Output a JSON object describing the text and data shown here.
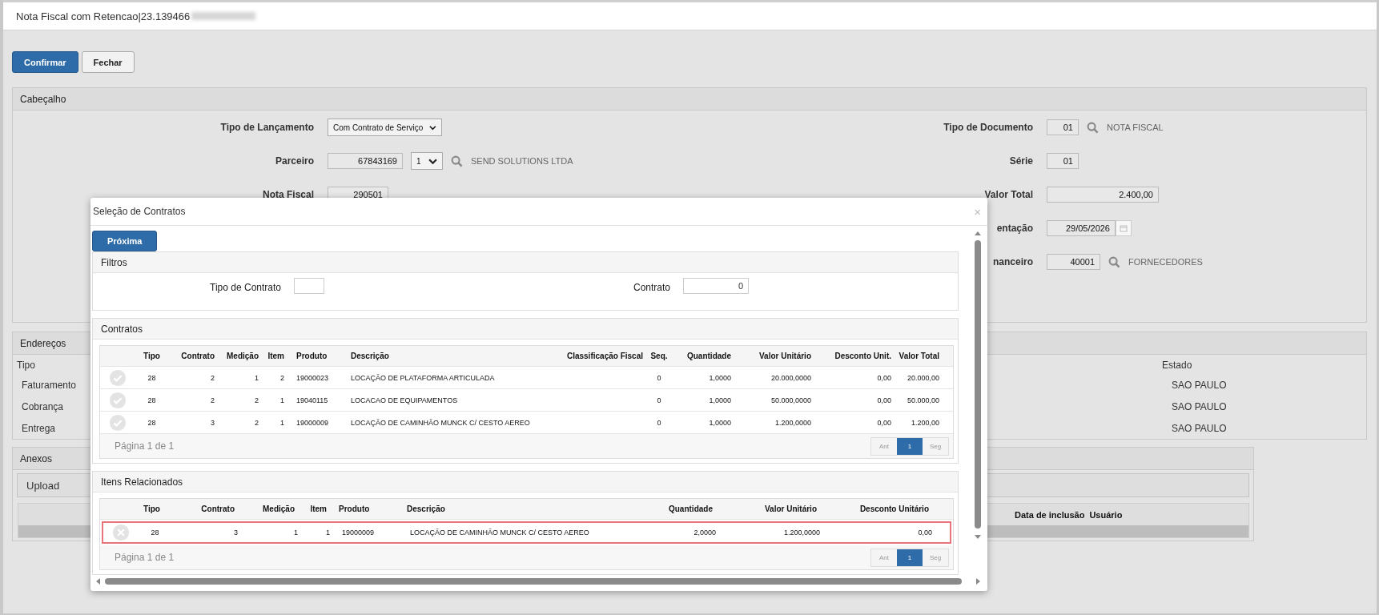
{
  "window": {
    "title": "Nota Fiscal com Retencao|23.139466"
  },
  "toolbar": [
    {
      "label": "Confirmar",
      "kind": "primary"
    },
    {
      "label": "Fechar",
      "kind": "default"
    }
  ],
  "cabecalho": {
    "title": "Cabeçalho",
    "left_fields": [
      {
        "label": "Tipo de Lançamento",
        "kind": "select",
        "value": "Com Contrato de Serviço"
      },
      {
        "label": "Parceiro",
        "kind": "input",
        "value": "67843169",
        "select": "1",
        "lookup": true,
        "description": "SEND SOLUTIONS LTDA"
      },
      {
        "label": "Nota Fiscal",
        "kind": "input",
        "value": "290501"
      }
    ],
    "right_fields": [
      {
        "label": "Tipo de Documento",
        "kind": "input",
        "value": "01",
        "lookup": true,
        "description": "NOTA FISCAL"
      },
      {
        "label": "Série",
        "kind": "input",
        "value": "01"
      },
      {
        "label": "Valor Total",
        "kind": "input",
        "value": "2.400,00"
      },
      {
        "label": "entação",
        "kind": "date",
        "value": "29/05/2026"
      },
      {
        "label": "nanceiro",
        "kind": "input",
        "value": "40001",
        "lookup": true,
        "description": "FORNECEDORES"
      }
    ]
  },
  "enderecos": {
    "title": "Endereços",
    "columns": [
      "Tipo",
      "Estado"
    ],
    "rows": [
      [
        "Faturamento",
        "SAO PAULO"
      ],
      [
        "Cobrança",
        "SAO PAULO"
      ],
      [
        "Entrega",
        "SAO PAULO"
      ]
    ]
  },
  "anexos": {
    "title": "Anexos",
    "upload": "Upload",
    "columns": [
      "Data de inclusão",
      "Usuário"
    ]
  },
  "modal": {
    "title": "Seleção de Contratos",
    "close": "×",
    "next_button": "Próxima",
    "filtros": {
      "title": "Filtros",
      "fields": [
        {
          "label": "Tipo de Contrato"
        },
        {
          "label": "Contrato",
          "value": "0"
        }
      ]
    },
    "contratos": {
      "title": "Contratos",
      "columns": [
        "Tipo",
        "Contrato",
        "Medição",
        "Item",
        "Produto",
        "Descrição",
        "Classificação Fiscal",
        "Seq.",
        "Quantidade",
        "Valor Unitário",
        "Desconto Unit.",
        "Valor Total"
      ],
      "rows": [
        {
          "kind": "check",
          "selected": false,
          "cells": [
            "28",
            "2",
            "1",
            "2",
            "19000023",
            "LOCAÇÃO DE PLATAFORMA ARTICULADA",
            "",
            "0",
            "1,0000",
            "20.000,0000",
            "0,00",
            "20.000,00"
          ]
        },
        {
          "kind": "check",
          "selected": false,
          "cells": [
            "28",
            "2",
            "2",
            "1",
            "19040115",
            "LOCACAO DE EQUIPAMENTOS",
            "",
            "0",
            "1,0000",
            "50.000,0000",
            "0,00",
            "50.000,00"
          ]
        },
        {
          "kind": "check",
          "selected": false,
          "cells": [
            "28",
            "3",
            "2",
            "1",
            "19000009",
            "LOCAÇÃO DE CAMINHÃO MUNCK C/ CESTO AEREO",
            "",
            "0",
            "1,0000",
            "1.200,0000",
            "0,00",
            "1.200,00"
          ]
        }
      ],
      "pager": {
        "label": "Página 1 de 1",
        "pages": [
          {
            "label": "Ant",
            "selected": false
          },
          {
            "label": "1",
            "selected": true
          },
          {
            "label": "Seg",
            "selected": false
          }
        ]
      }
    },
    "itens": {
      "title": "Itens Relacionados",
      "columns": [
        "Tipo",
        "Contrato",
        "Medição",
        "Item",
        "Produto",
        "Descrição",
        "Quantidade",
        "Valor Unitário",
        "Desconto Unitário"
      ],
      "rows": [
        {
          "kind": "remove",
          "selected": true,
          "cells": [
            "28",
            "3",
            "1",
            "1",
            "19000009",
            "LOCAÇÃO DE CAMINHÃO MUNCK C/ CESTO AEREO",
            "2,0000",
            "1.200,0000",
            "0,00"
          ]
        }
      ],
      "pager": {
        "label": "Página 1 de 1",
        "pages": [
          {
            "label": "Ant",
            "selected": false
          },
          {
            "label": "1",
            "selected": true
          },
          {
            "label": "Seg",
            "selected": false
          }
        ]
      }
    }
  }
}
